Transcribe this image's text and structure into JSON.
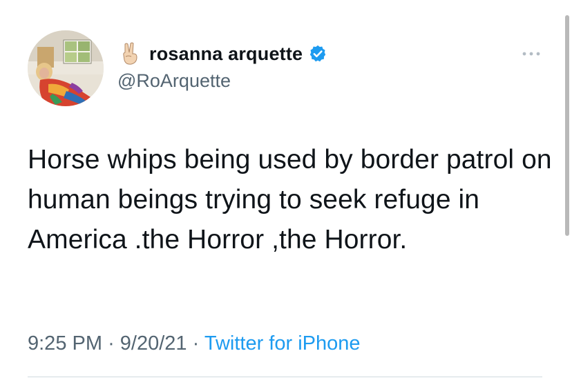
{
  "tweet": {
    "author": {
      "display_name": "rosanna arquette",
      "handle": "@RoArquette",
      "name_emoji": "peace-hand-icon",
      "verified_icon": "verified-badge-icon"
    },
    "text": "Horse whips being used by border patrol on human beings trying to seek refuge in America .the Horror ,the Horror.",
    "time": "9:25 PM",
    "separator": "·",
    "date": "9/20/21",
    "source": "Twitter for iPhone",
    "menu_icon": "more-icon"
  },
  "colors": {
    "text_primary": "#0f1419",
    "text_secondary": "#536471",
    "accent": "#1d9bf0",
    "divider": "#cfd9de"
  }
}
